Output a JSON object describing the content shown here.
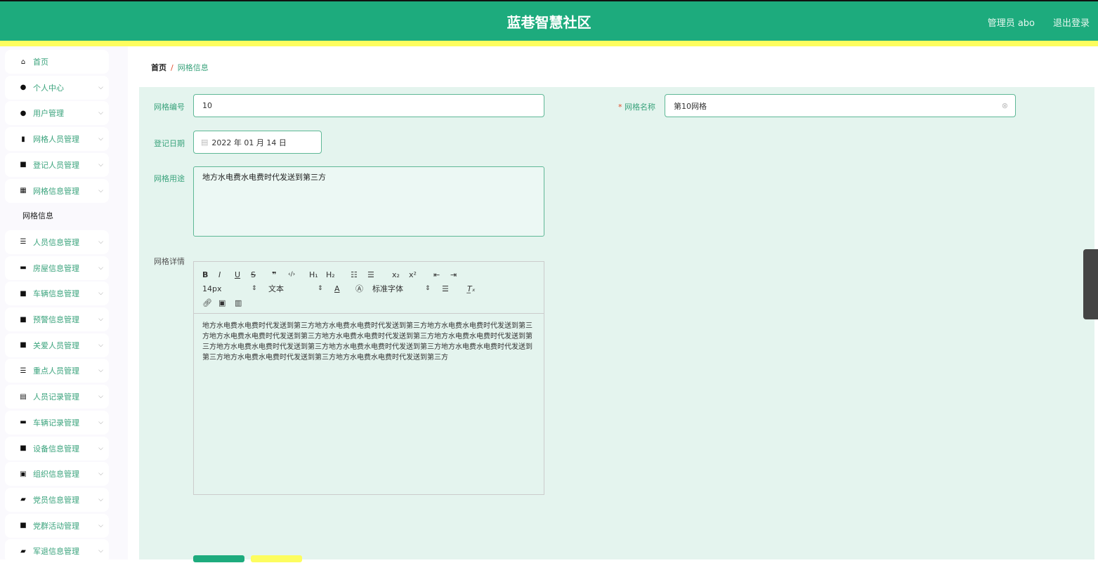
{
  "header": {
    "title": "蓝巷智慧社区",
    "user": "管理员 abo",
    "logout": "退出登录"
  },
  "sidebar": {
    "items": [
      {
        "label": "首页",
        "icon": "home-icon",
        "glyph": "⌂",
        "chev": false
      },
      {
        "label": "个人中心",
        "icon": "user-icon",
        "glyph": "●",
        "chev": true
      },
      {
        "label": "用户管理",
        "icon": "bulb-icon",
        "glyph": "●",
        "chev": true
      },
      {
        "label": "网格人员管理",
        "icon": "bar-chart-icon",
        "glyph": "▮",
        "chev": true
      },
      {
        "label": "登记人员管理",
        "icon": "grid-icon",
        "glyph": "■",
        "chev": true
      },
      {
        "label": "网格信息管理",
        "icon": "grid-small-icon",
        "glyph": "▦",
        "chev": true
      },
      {
        "label": "人员信息管理",
        "icon": "sliders-icon",
        "glyph": "☰",
        "chev": true
      },
      {
        "label": "房屋信息管理",
        "icon": "monitor-icon",
        "glyph": "▬",
        "chev": true
      },
      {
        "label": "车辆信息管理",
        "icon": "grid-icon",
        "glyph": "■",
        "chev": true
      },
      {
        "label": "预警信息管理",
        "icon": "grid-icon",
        "glyph": "■",
        "chev": true
      },
      {
        "label": "关爱人员管理",
        "icon": "grid-icon",
        "glyph": "■",
        "chev": true
      },
      {
        "label": "重点人员管理",
        "icon": "list-icon",
        "glyph": "☰",
        "chev": true
      },
      {
        "label": "人员记录管理",
        "icon": "clipboard-icon",
        "glyph": "▤",
        "chev": true
      },
      {
        "label": "车辆记录管理",
        "icon": "ticket-icon",
        "glyph": "▬",
        "chev": true
      },
      {
        "label": "设备信息管理",
        "icon": "grid-icon",
        "glyph": "■",
        "chev": true
      },
      {
        "label": "组织信息管理",
        "icon": "clipboard-check-icon",
        "glyph": "▣",
        "chev": true
      },
      {
        "label": "党员信息管理",
        "icon": "wallet-icon",
        "glyph": "▰",
        "chev": true
      },
      {
        "label": "党群活动管理",
        "icon": "grid-icon",
        "glyph": "■",
        "chev": true
      },
      {
        "label": "军退信息管理",
        "icon": "briefcase-icon",
        "glyph": "▰",
        "chev": true
      }
    ],
    "sub_item": "网格信息"
  },
  "breadcrumb": {
    "home": "首页",
    "sep": "/",
    "current": "网格信息"
  },
  "form": {
    "code_label": "网格编号",
    "code_value": "10",
    "name_label": "网格名称",
    "name_required": "*",
    "name_value": "第10网格",
    "date_label": "登记日期",
    "date_value": "2022 年 01 月 14 日",
    "use_label": "网格用途",
    "use_value": "地方水电费水电费时代发送到第三方",
    "detail_label": "网格详情",
    "toolbar": {
      "size": "14px",
      "block": "文本",
      "font": "标准字体"
    },
    "detail_value": "地方水电费水电费时代发送到第三方地方水电费水电费时代发送到第三方地方水电费水电费时代发送到第三方地方水电费水电费时代发送到第三方地方水电费水电费时代发送到第三方地方水电费水电费时代发送到第三方地方水电费水电费时代发送到第三方地方水电费水电费时代发送到第三方地方水电费水电费时代发送到第三方地方水电费水电费时代发送到第三方地方水电费水电费时代发送到第三方"
  },
  "colors": {
    "primary": "#1dab7d",
    "accent": "#fdfd5e",
    "label": "#3aa37c"
  }
}
